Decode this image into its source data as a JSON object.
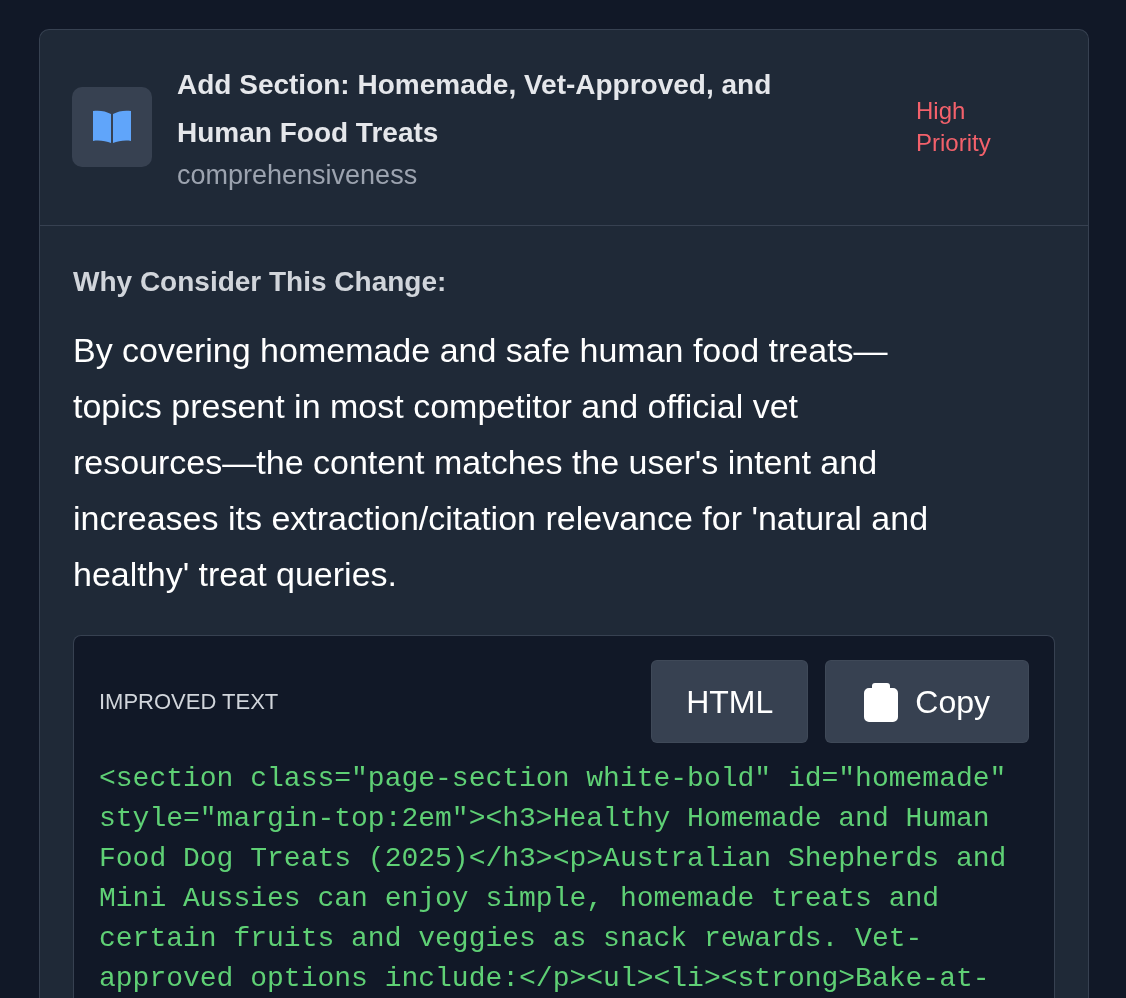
{
  "card": {
    "title": "Add Section: Homemade, Vet-Approved, and Human Food Treats",
    "category": "comprehensiveness",
    "priority": {
      "label": "High Priority",
      "kind": "high"
    }
  },
  "why": {
    "heading": "Why Consider This Change:",
    "text": "By covering homemade and safe human food treats—topics present in most competitor and official vet resources—the content matches the user's intent and increases its extraction/citation relevance for 'natural and healthy' treat queries."
  },
  "improved_text": {
    "label": "IMPROVED TEXT",
    "buttons": [
      {
        "label": "HTML",
        "kind": "format"
      },
      {
        "label": "Copy",
        "kind": "copy"
      }
    ],
    "code": "<section class=\"page-section white-bold\" id=\"homemade\" style=\"margin-top:2em\"><h3>Healthy Homemade and Human Food Dog Treats (2025)</h3><p>Australian Shepherds and Mini Aussies can enjoy simple, homemade treats and certain fruits and veggies as snack rewards. Vet-approved options include:</p><ul><li><strong>Bake-at-"
  }
}
